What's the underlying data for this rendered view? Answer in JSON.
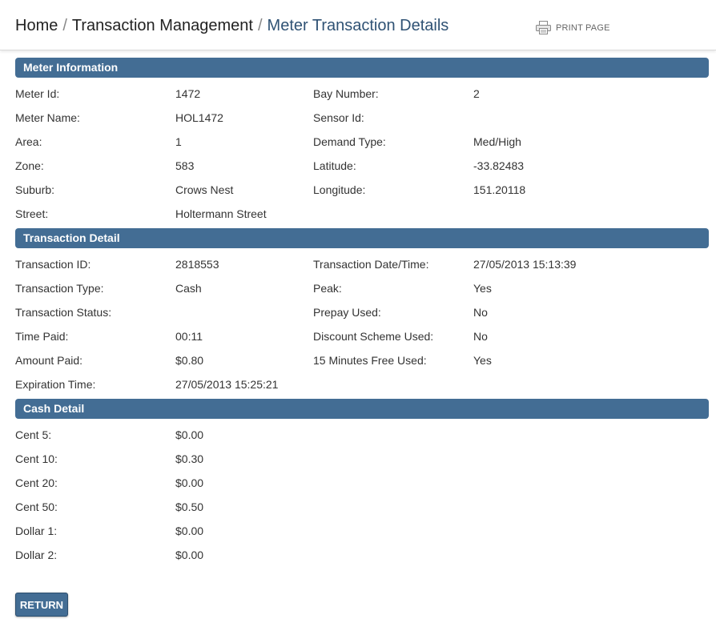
{
  "breadcrumb": {
    "home": "Home",
    "sep": "/",
    "level2": "Transaction Management",
    "current": "Meter Transaction Details"
  },
  "print_label": "PRINT PAGE",
  "sections": {
    "meter": "Meter Information",
    "transaction": "Transaction Detail",
    "cash": "Cash Detail"
  },
  "meter": {
    "rows": [
      {
        "l1": "Meter Id:",
        "v1": "1472",
        "l2": "Bay Number:",
        "v2": "2"
      },
      {
        "l1": "Meter Name:",
        "v1": "HOL1472",
        "l2": "Sensor Id:",
        "v2": ""
      },
      {
        "l1": "Area:",
        "v1": "1",
        "l2": "Demand Type:",
        "v2": "Med/High"
      },
      {
        "l1": "Zone:",
        "v1": "583",
        "l2": "Latitude:",
        "v2": "-33.82483"
      },
      {
        "l1": "Suburb:",
        "v1": "Crows Nest",
        "l2": "Longitude:",
        "v2": "151.20118"
      },
      {
        "l1": "Street:",
        "v1": "Holtermann Street",
        "l2": "",
        "v2": ""
      }
    ]
  },
  "transaction": {
    "rows": [
      {
        "l1": "Transaction ID:",
        "v1": "2818553",
        "l2": "Transaction Date/Time:",
        "v2": "27/05/2013 15:13:39"
      },
      {
        "l1": "Transaction Type:",
        "v1": "Cash",
        "l2": "Peak:",
        "v2": "Yes"
      },
      {
        "l1": "Transaction Status:",
        "v1": "",
        "l2": "Prepay Used:",
        "v2": "No"
      },
      {
        "l1": "Time Paid:",
        "v1": "00:11",
        "l2": "Discount Scheme Used:",
        "v2": "No"
      },
      {
        "l1": "Amount Paid:",
        "v1": "$0.80",
        "l2": "15 Minutes Free Used:",
        "v2": "Yes"
      },
      {
        "l1": "Expiration Time:",
        "v1": "27/05/2013 15:25:21",
        "l2": "",
        "v2": ""
      }
    ]
  },
  "cash": {
    "rows": [
      {
        "l1": "Cent 5:",
        "v1": "$0.00"
      },
      {
        "l1": "Cent 10:",
        "v1": "$0.30"
      },
      {
        "l1": "Cent 20:",
        "v1": "$0.00"
      },
      {
        "l1": "Cent 50:",
        "v1": "$0.50"
      },
      {
        "l1": "Dollar 1:",
        "v1": "$0.00"
      },
      {
        "l1": "Dollar 2:",
        "v1": "$0.00"
      }
    ]
  },
  "return_label": "RETURN",
  "colors": {
    "section_bar": "#436d94",
    "breadcrumb_current": "#2f5274"
  },
  "icons": {
    "print": "printer-icon"
  }
}
